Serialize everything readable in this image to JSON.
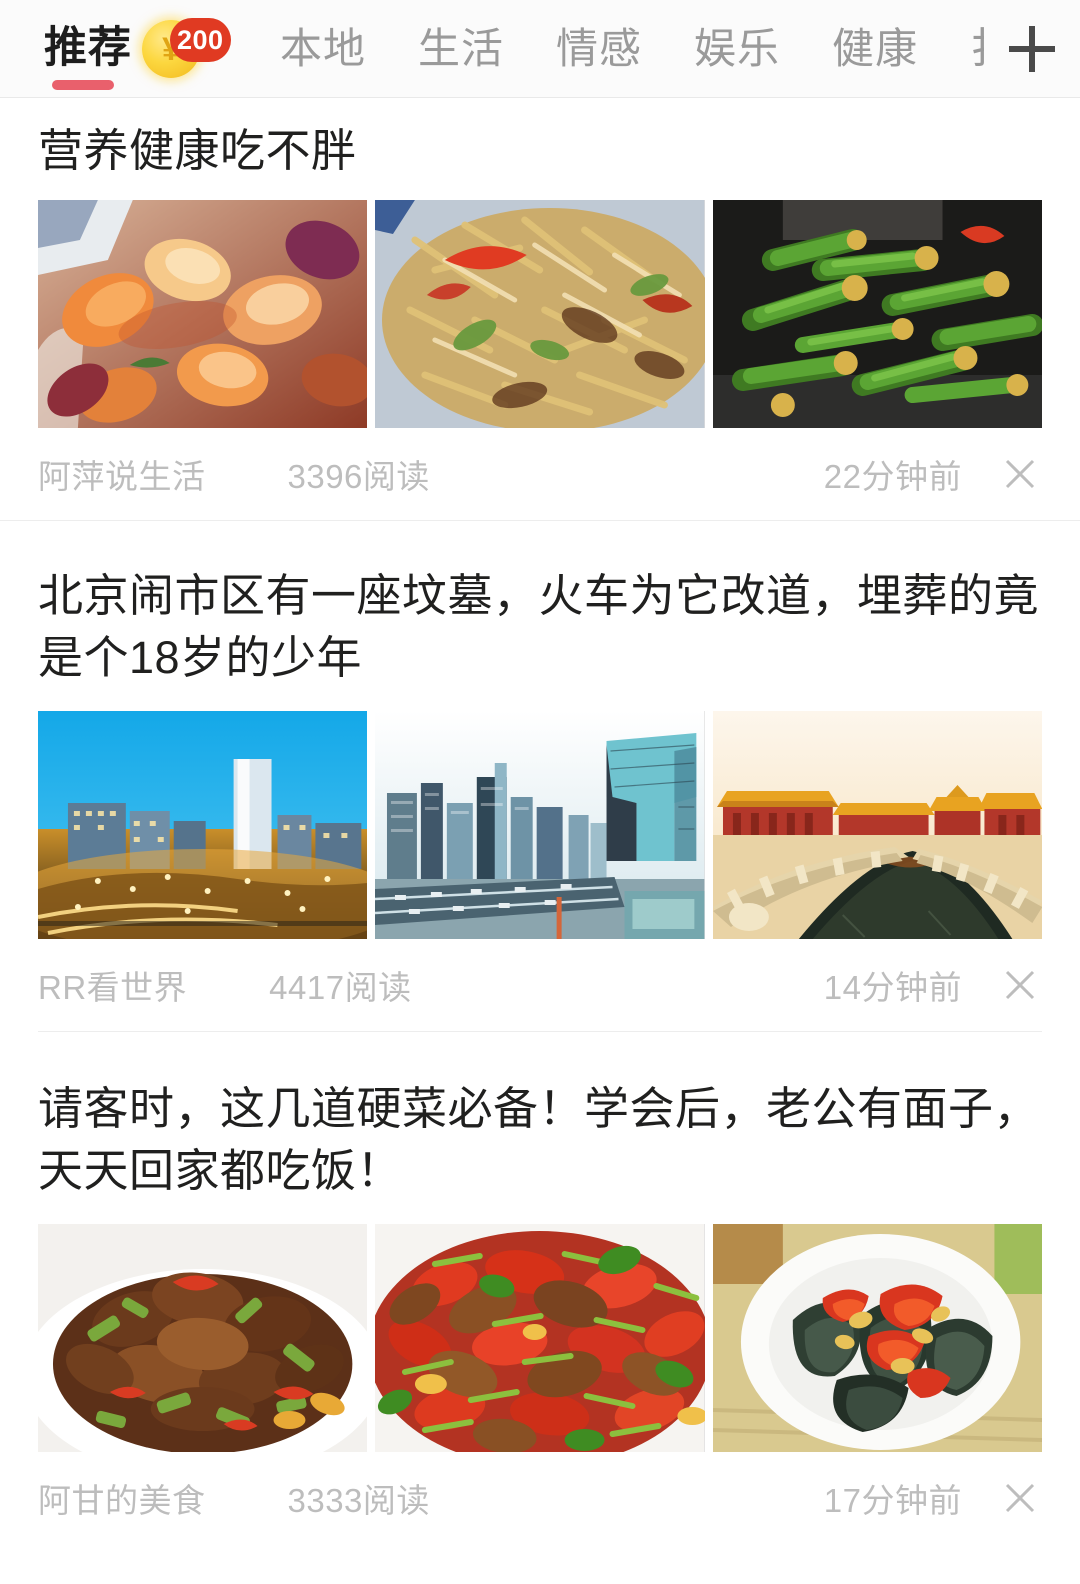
{
  "tabbar": {
    "tabs": [
      {
        "label": "推荐",
        "active": true
      },
      {
        "label": "本地",
        "active": false
      },
      {
        "label": "生活",
        "active": false
      },
      {
        "label": "情感",
        "active": false
      },
      {
        "label": "娱乐",
        "active": false
      },
      {
        "label": "健康",
        "active": false
      },
      {
        "label": "扌",
        "active": false
      }
    ],
    "coin_symbol": "¥",
    "coin_badge_count": "200",
    "add_button_icon": "plus-icon",
    "active_color": "#e9606c",
    "badge_color": "#e03a22",
    "coin_color": "#fcd73f"
  },
  "feed": {
    "articles": [
      {
        "title": "营养健康吃不胖",
        "source": "阿萍说生活",
        "reads": "3396阅读",
        "time": "22分钟前",
        "close_icon": "close-icon",
        "thumbs": [
          {
            "alt": "braised-shrimp-dish"
          },
          {
            "alt": "shredded-potato-stirfry"
          },
          {
            "alt": "stirfried-green-beans"
          }
        ]
      },
      {
        "title": "北京闹市区有一座坟墓，火车为它改道，埋葬的竟是个18岁的少年",
        "source": "RR看世界",
        "reads": "4417阅读",
        "time": "14分钟前",
        "close_icon": "close-icon",
        "thumbs": [
          {
            "alt": "beijing-city-night-skyline"
          },
          {
            "alt": "beijing-cbd-cctv-tower"
          },
          {
            "alt": "forbidden-city-moat-bridge"
          }
        ]
      },
      {
        "title": "请客时，这几道硬菜必备！学会后，老公有面子，天天回家都吃饭！",
        "source": "阿甘的美食",
        "reads": "3333阅读",
        "time": "17分钟前",
        "close_icon": "close-icon",
        "thumbs": [
          {
            "alt": "beef-with-celery-stirfry"
          },
          {
            "alt": "beef-with-red-pepper-stirfry"
          },
          {
            "alt": "century-eggs-with-chili"
          }
        ]
      }
    ]
  }
}
